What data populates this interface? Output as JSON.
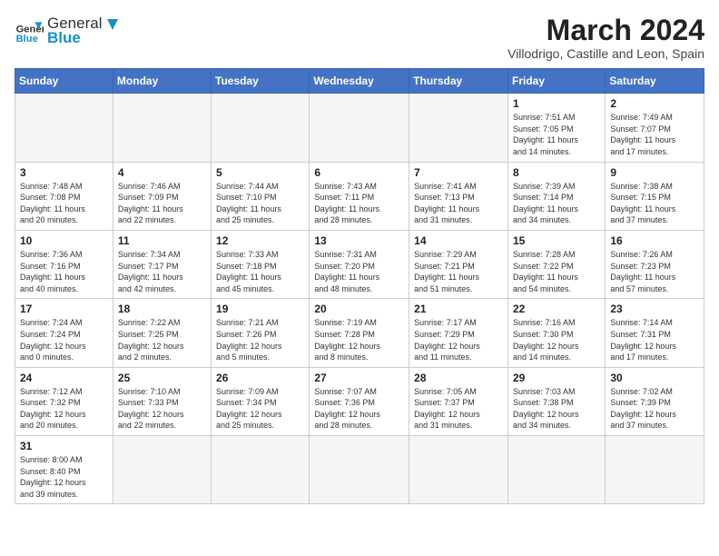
{
  "header": {
    "logo_general": "General",
    "logo_blue": "Blue",
    "month_year": "March 2024",
    "location": "Villodrigo, Castille and Leon, Spain"
  },
  "weekdays": [
    "Sunday",
    "Monday",
    "Tuesday",
    "Wednesday",
    "Thursday",
    "Friday",
    "Saturday"
  ],
  "weeks": [
    [
      {
        "day": "",
        "info": ""
      },
      {
        "day": "",
        "info": ""
      },
      {
        "day": "",
        "info": ""
      },
      {
        "day": "",
        "info": ""
      },
      {
        "day": "",
        "info": ""
      },
      {
        "day": "1",
        "info": "Sunrise: 7:51 AM\nSunset: 7:05 PM\nDaylight: 11 hours\nand 14 minutes."
      },
      {
        "day": "2",
        "info": "Sunrise: 7:49 AM\nSunset: 7:07 PM\nDaylight: 11 hours\nand 17 minutes."
      }
    ],
    [
      {
        "day": "3",
        "info": "Sunrise: 7:48 AM\nSunset: 7:08 PM\nDaylight: 11 hours\nand 20 minutes."
      },
      {
        "day": "4",
        "info": "Sunrise: 7:46 AM\nSunset: 7:09 PM\nDaylight: 11 hours\nand 22 minutes."
      },
      {
        "day": "5",
        "info": "Sunrise: 7:44 AM\nSunset: 7:10 PM\nDaylight: 11 hours\nand 25 minutes."
      },
      {
        "day": "6",
        "info": "Sunrise: 7:43 AM\nSunset: 7:11 PM\nDaylight: 11 hours\nand 28 minutes."
      },
      {
        "day": "7",
        "info": "Sunrise: 7:41 AM\nSunset: 7:13 PM\nDaylight: 11 hours\nand 31 minutes."
      },
      {
        "day": "8",
        "info": "Sunrise: 7:39 AM\nSunset: 7:14 PM\nDaylight: 11 hours\nand 34 minutes."
      },
      {
        "day": "9",
        "info": "Sunrise: 7:38 AM\nSunset: 7:15 PM\nDaylight: 11 hours\nand 37 minutes."
      }
    ],
    [
      {
        "day": "10",
        "info": "Sunrise: 7:36 AM\nSunset: 7:16 PM\nDaylight: 11 hours\nand 40 minutes."
      },
      {
        "day": "11",
        "info": "Sunrise: 7:34 AM\nSunset: 7:17 PM\nDaylight: 11 hours\nand 42 minutes."
      },
      {
        "day": "12",
        "info": "Sunrise: 7:33 AM\nSunset: 7:18 PM\nDaylight: 11 hours\nand 45 minutes."
      },
      {
        "day": "13",
        "info": "Sunrise: 7:31 AM\nSunset: 7:20 PM\nDaylight: 11 hours\nand 48 minutes."
      },
      {
        "day": "14",
        "info": "Sunrise: 7:29 AM\nSunset: 7:21 PM\nDaylight: 11 hours\nand 51 minutes."
      },
      {
        "day": "15",
        "info": "Sunrise: 7:28 AM\nSunset: 7:22 PM\nDaylight: 11 hours\nand 54 minutes."
      },
      {
        "day": "16",
        "info": "Sunrise: 7:26 AM\nSunset: 7:23 PM\nDaylight: 11 hours\nand 57 minutes."
      }
    ],
    [
      {
        "day": "17",
        "info": "Sunrise: 7:24 AM\nSunset: 7:24 PM\nDaylight: 12 hours\nand 0 minutes."
      },
      {
        "day": "18",
        "info": "Sunrise: 7:22 AM\nSunset: 7:25 PM\nDaylight: 12 hours\nand 2 minutes."
      },
      {
        "day": "19",
        "info": "Sunrise: 7:21 AM\nSunset: 7:26 PM\nDaylight: 12 hours\nand 5 minutes."
      },
      {
        "day": "20",
        "info": "Sunrise: 7:19 AM\nSunset: 7:28 PM\nDaylight: 12 hours\nand 8 minutes."
      },
      {
        "day": "21",
        "info": "Sunrise: 7:17 AM\nSunset: 7:29 PM\nDaylight: 12 hours\nand 11 minutes."
      },
      {
        "day": "22",
        "info": "Sunrise: 7:16 AM\nSunset: 7:30 PM\nDaylight: 12 hours\nand 14 minutes."
      },
      {
        "day": "23",
        "info": "Sunrise: 7:14 AM\nSunset: 7:31 PM\nDaylight: 12 hours\nand 17 minutes."
      }
    ],
    [
      {
        "day": "24",
        "info": "Sunrise: 7:12 AM\nSunset: 7:32 PM\nDaylight: 12 hours\nand 20 minutes."
      },
      {
        "day": "25",
        "info": "Sunrise: 7:10 AM\nSunset: 7:33 PM\nDaylight: 12 hours\nand 22 minutes."
      },
      {
        "day": "26",
        "info": "Sunrise: 7:09 AM\nSunset: 7:34 PM\nDaylight: 12 hours\nand 25 minutes."
      },
      {
        "day": "27",
        "info": "Sunrise: 7:07 AM\nSunset: 7:36 PM\nDaylight: 12 hours\nand 28 minutes."
      },
      {
        "day": "28",
        "info": "Sunrise: 7:05 AM\nSunset: 7:37 PM\nDaylight: 12 hours\nand 31 minutes."
      },
      {
        "day": "29",
        "info": "Sunrise: 7:03 AM\nSunset: 7:38 PM\nDaylight: 12 hours\nand 34 minutes."
      },
      {
        "day": "30",
        "info": "Sunrise: 7:02 AM\nSunset: 7:39 PM\nDaylight: 12 hours\nand 37 minutes."
      }
    ],
    [
      {
        "day": "31",
        "info": "Sunrise: 8:00 AM\nSunset: 8:40 PM\nDaylight: 12 hours\nand 39 minutes."
      },
      {
        "day": "",
        "info": ""
      },
      {
        "day": "",
        "info": ""
      },
      {
        "day": "",
        "info": ""
      },
      {
        "day": "",
        "info": ""
      },
      {
        "day": "",
        "info": ""
      },
      {
        "day": "",
        "info": ""
      }
    ]
  ]
}
